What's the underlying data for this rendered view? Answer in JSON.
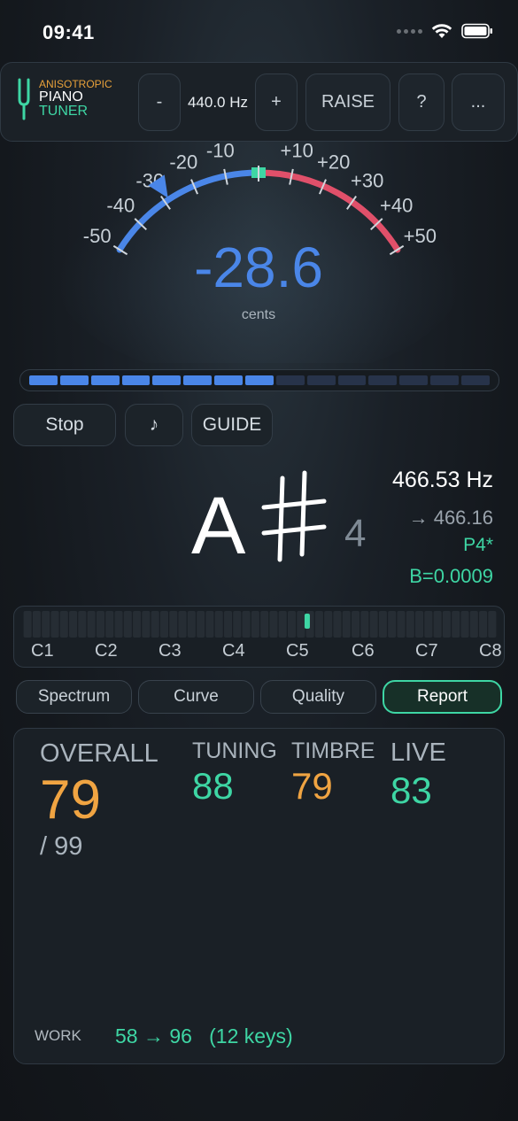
{
  "status": {
    "time": "09:41"
  },
  "header": {
    "logo_line1": "ANISOTROPIC",
    "logo_line2": "PIANO",
    "logo_line3": "TUNER",
    "minus_label": "-",
    "pitch_label": "440.0 Hz",
    "plus_label": "+",
    "raise_label": "RAISE",
    "help_label": "?",
    "more_label": "..."
  },
  "gauge": {
    "reading": "-28.6",
    "unit": "cents",
    "value_cents": -28.6,
    "ticks_left": [
      "-50",
      "-40",
      "-30",
      "-20",
      "-10"
    ],
    "ticks_right": [
      "+10",
      "+20",
      "+30",
      "+40",
      "+50"
    ]
  },
  "level_meter": {
    "lit_segments": 8,
    "total_segments": 15
  },
  "controls": {
    "stop_label": "Stop",
    "note_label": "♪",
    "guide_label": "GUIDE"
  },
  "note": {
    "letter": "A",
    "octave": "4",
    "frequency": "466.53 Hz",
    "target": "→ 466.16",
    "partial": "P4*",
    "inharmonicity": "B=0.0009"
  },
  "keyboard": {
    "octaves": [
      "C1",
      "C2",
      "C3",
      "C4",
      "C5",
      "C6",
      "C7",
      "C8"
    ],
    "highlighted_key": "A#4"
  },
  "tabs": [
    "Spectrum",
    "Curve",
    "Quality",
    "Report"
  ],
  "active_tab": "Report",
  "report": {
    "overall_label": "OVERALL",
    "overall_value": "79",
    "overall_max": "/ 99",
    "tuning_label": "TUNING",
    "tuning_value": "88",
    "timbre_label": "TIMBRE",
    "timbre_value": "79",
    "live_label": "LIVE",
    "live_value": "83",
    "work_label": "WORK",
    "work_value": "58 → 96   (12 keys)"
  },
  "colors": {
    "accent_green": "#3ed6a4",
    "accent_orange": "#f0a442",
    "accent_blue": "#4a86e8",
    "accent_red": "#e0506a"
  }
}
